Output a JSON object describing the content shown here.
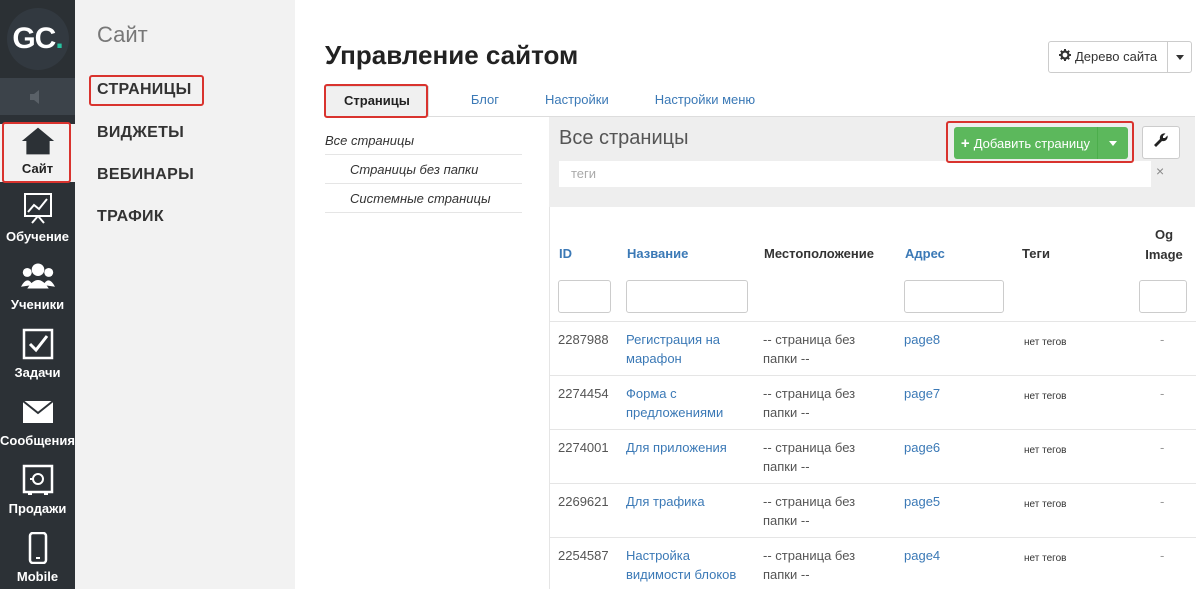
{
  "logo": {
    "text": "GC",
    "dot": "."
  },
  "rail": [
    {
      "label": "Сайт",
      "icon": "home-icon"
    },
    {
      "label": "Обучение",
      "icon": "chart-board-icon"
    },
    {
      "label": "Ученики",
      "icon": "users-icon"
    },
    {
      "label": "Задачи",
      "icon": "checkbox-icon"
    },
    {
      "label": "Сообщения",
      "icon": "envelope-icon"
    },
    {
      "label": "Продажи",
      "icon": "safe-icon"
    },
    {
      "label": "Mobile",
      "icon": "phone-icon"
    }
  ],
  "subnav": {
    "title": "Сайт",
    "items": [
      "СТРАНИЦЫ",
      "ВИДЖЕТЫ",
      "ВЕБИНАРЫ",
      "ТРАФИК"
    ]
  },
  "main": {
    "title": "Управление сайтом",
    "tree_button": "Дерево сайта",
    "tabs": [
      "Страницы",
      "Блог",
      "Настройки",
      "Настройки меню"
    ],
    "folders": [
      "Все страницы",
      "Страницы без папки",
      "Системные страницы"
    ],
    "panel_title": "Все страницы",
    "add_button": "Добавить страницу",
    "tags_placeholder": "теги",
    "tags_clear": "×"
  },
  "table": {
    "headers": {
      "id": "ID",
      "name": "Название",
      "location": "Местоположение",
      "address": "Адрес",
      "tags": "Теги",
      "og_image": "Og Image"
    },
    "rows": [
      {
        "id": "2287988",
        "name": "Регистрация на марафон",
        "location": "-- страница без папки --",
        "address": "page8",
        "tags": "нет тегов",
        "og": "-"
      },
      {
        "id": "2274454",
        "name": "Форма с предложениями",
        "location": "-- страница без папки --",
        "address": "page7",
        "tags": "нет тегов",
        "og": "-"
      },
      {
        "id": "2274001",
        "name": "Для приложения",
        "location": "-- страница без папки --",
        "address": "page6",
        "tags": "нет тегов",
        "og": "-"
      },
      {
        "id": "2269621",
        "name": "Для трафика",
        "location": "-- страница без папки --",
        "address": "page5",
        "tags": "нет тегов",
        "og": "-"
      },
      {
        "id": "2254587",
        "name": "Настройка видимости блоков",
        "location": "-- страница без папки --",
        "address": "page4",
        "tags": "нет тегов",
        "og": "-"
      }
    ]
  },
  "colors": {
    "rail_bg": "#2c3136",
    "accent_green": "#5cb85c",
    "link": "#3b79b6",
    "highlight_red": "#d9332e",
    "logo_dot": "#27c3a0"
  }
}
